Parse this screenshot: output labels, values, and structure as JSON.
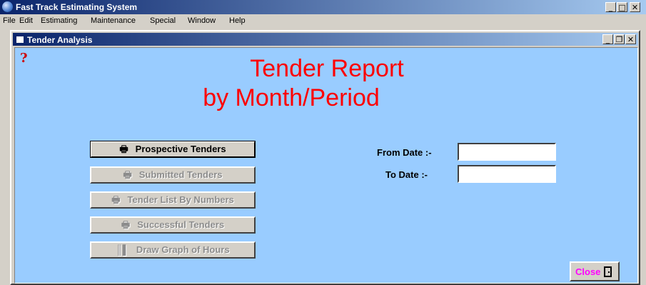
{
  "app": {
    "title": "Fast Track Estimating System",
    "controls": [
      "_",
      "□",
      "✕"
    ]
  },
  "menu": [
    "File",
    "Edit",
    "Estimating",
    "Maintenance",
    "Special",
    "Window",
    "Help"
  ],
  "child": {
    "title": "Tender Analysis",
    "controls": [
      "_",
      "❐",
      "✕"
    ]
  },
  "help_glyph": "?",
  "heading": {
    "line1": "Tender Report",
    "line2": "by  Month/Period"
  },
  "buttons": [
    {
      "label": "Prospective Tenders",
      "icon": "printer-icon",
      "glyph": "🖶",
      "enabled": true
    },
    {
      "label": "Submitted Tenders",
      "icon": "printer-icon",
      "glyph": "🖶",
      "enabled": false
    },
    {
      "label": "Tender List By Numbers",
      "icon": "printer-icon",
      "glyph": "🖶",
      "enabled": false
    },
    {
      "label": "Successful Tenders",
      "icon": "printer-icon",
      "glyph": "🖶",
      "enabled": false
    },
    {
      "label": "Draw Graph of Hours",
      "icon": "bar-chart-icon",
      "glyph": "║▌",
      "enabled": false
    }
  ],
  "fields": {
    "from_label": "From Date :-",
    "from_value": "",
    "to_label": "To  Date :-",
    "to_value": ""
  },
  "close": {
    "label": "Close",
    "icon": "door-exit-icon"
  },
  "colors": {
    "client_bg": "#99ccff",
    "heading": "#ff0000",
    "close_label": "#ff00ff",
    "titlebar": "#0a246a"
  }
}
